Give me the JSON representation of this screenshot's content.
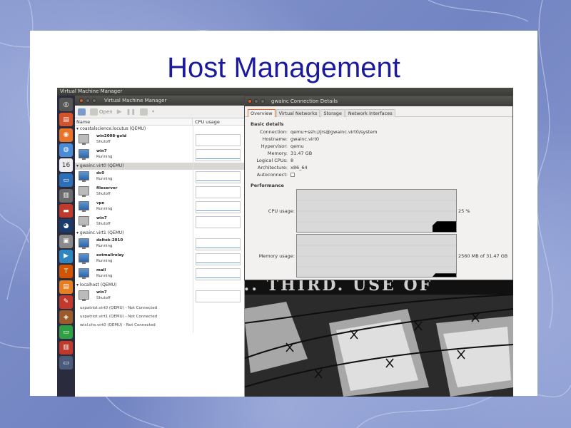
{
  "slide": {
    "title": "Host Management"
  },
  "desktop": {
    "top_panel_title": "Virtual Machine Manager",
    "launcher_icons": [
      "dash-icon",
      "files-icon",
      "firefox-icon",
      "chrome-icon",
      "calendar-icon",
      "remote-desktop-icon",
      "virt-manager-icon",
      "terminal-icon",
      "tor-icon",
      "chip-icon",
      "play-icon",
      "transmission-icon",
      "document-icon",
      "inkscape-icon",
      "gimp-icon",
      "monitor-icon",
      "trash-icon",
      "screen-icon"
    ],
    "launcher_badge": "16"
  },
  "vmm": {
    "window_title": "Virtual Machine Manager",
    "toolbar": {
      "open_label": "Open"
    },
    "columns": {
      "name": "Name",
      "cpu": "CPU usage"
    },
    "connections": [
      {
        "label": "coastalscience.locutus (QEMU)",
        "selected": false,
        "vms": [
          {
            "name": "win2008-gold",
            "state": "Shutoff"
          },
          {
            "name": "win7",
            "state": "Running"
          }
        ]
      },
      {
        "label": "gwainc.virt0 (QEMU)",
        "selected": true,
        "vms": [
          {
            "name": "dc0",
            "state": "Running"
          },
          {
            "name": "fileserver",
            "state": "Shutoff"
          },
          {
            "name": "vpn",
            "state": "Running"
          },
          {
            "name": "win7",
            "state": "Shutoff"
          }
        ]
      },
      {
        "label": "gwainc.virt1 (QEMU)",
        "selected": false,
        "vms": [
          {
            "name": "deltek-2010",
            "state": "Running"
          },
          {
            "name": "extmailrelay",
            "state": "Running"
          },
          {
            "name": "mail",
            "state": "Running"
          }
        ]
      },
      {
        "label": "localhost (QEMU)",
        "selected": false,
        "vms": [
          {
            "name": "win7",
            "state": "Shutoff"
          }
        ]
      }
    ],
    "not_connected": [
      "uspatriot.virt0 (QEMU) - Not Connected",
      "uspatriot.virt1 (QEMU) - Not Connected",
      "wtsl.chs.virt0 (QEMU) - Not Connected"
    ]
  },
  "details": {
    "window_title": "gwainc Connection Details",
    "tabs": [
      "Overview",
      "Virtual Networks",
      "Storage",
      "Network Interfaces"
    ],
    "active_tab": "Overview",
    "basic_title": "Basic details",
    "basic": [
      {
        "k": "Connection:",
        "v": "qemu+ssh://jrs@gwainc.virt0/system"
      },
      {
        "k": "Hostname:",
        "v": "gwainc.virt0"
      },
      {
        "k": "Hypervisor:",
        "v": "qemu"
      },
      {
        "k": "Memory:",
        "v": "31.47 GB"
      },
      {
        "k": "Logical CPUs:",
        "v": "8"
      },
      {
        "k": "Architecture:",
        "v": "x86_64"
      }
    ],
    "autoconnect_label": "Autoconnect:",
    "performance_title": "Performance",
    "cpu_label": "CPU usage:",
    "cpu_value": "25 %",
    "memory_label": "Memory usage:",
    "memory_value": "2560 MB of 31.47 GB",
    "cpu_usage_fraction": 0.25,
    "memory_usage_fraction": 0.08
  },
  "wallpaper": {
    "text": "... THIRD. USE OF"
  }
}
